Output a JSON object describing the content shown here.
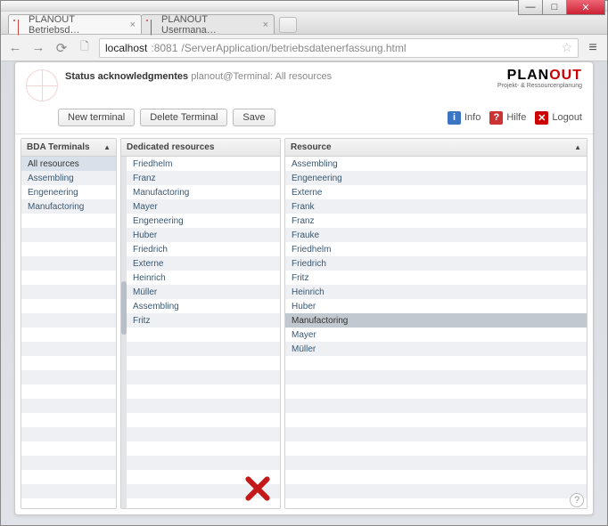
{
  "window": {
    "tabs": [
      {
        "title": "PLANOUT Betriebsd…"
      },
      {
        "title": "PLANOUT Usermana…"
      }
    ]
  },
  "address": {
    "host": "localhost",
    "port": ":8081",
    "path": "/ServerApplication/betriebsdatenerfassung.html"
  },
  "brand": {
    "name_black": "PLAN",
    "name_red": "OUT",
    "tagline": "Projekt- & Ressourcenplanung"
  },
  "status": {
    "label": "Status acknowledgmentes",
    "context": "planout@Terminal: All resources"
  },
  "toolbar": {
    "new_terminal": "New terminal",
    "delete_terminal": "Delete Terminal",
    "save": "Save",
    "info": "Info",
    "help": "Hilfe",
    "logout": "Logout"
  },
  "panels": {
    "bda": {
      "title": "BDA Terminals",
      "items": [
        "All resources",
        "Assembling",
        "Engeneering",
        "Manufactoring"
      ],
      "selected_index": 0
    },
    "dedicated": {
      "title": "Dedicated resources",
      "items": [
        "Friedhelm",
        "Franz",
        "Manufactoring",
        "Mayer",
        "Engeneering",
        "Huber",
        "Friedrich",
        "Externe",
        "Heinrich",
        "Müller",
        "Assembling",
        "Fritz"
      ]
    },
    "resource": {
      "title": "Resource",
      "items": [
        "Assembling",
        "Engeneering",
        "Externe",
        "Frank",
        "Franz",
        "Frauke",
        "Friedhelm",
        "Friedrich",
        "Fritz",
        "Heinrich",
        "Huber",
        "Manufactoring",
        "Mayer",
        "Müller"
      ],
      "highlight_index": 11
    }
  }
}
